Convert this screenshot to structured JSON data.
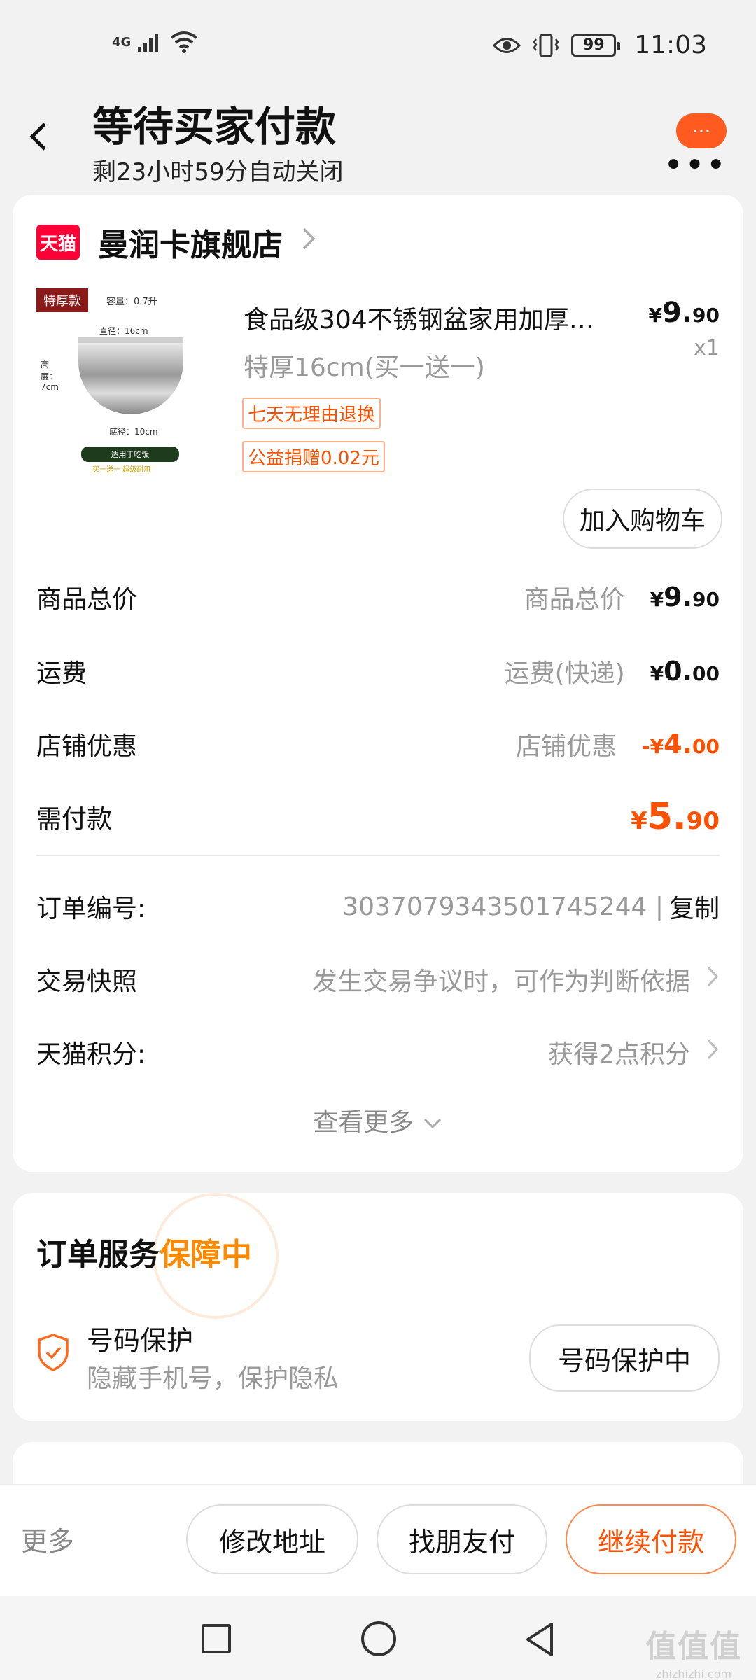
{
  "status_bar": {
    "network": "4G",
    "battery": "99",
    "time": "11:03"
  },
  "header": {
    "title": "等待买家付款",
    "subtitle": "剩23小时59分自动关闭",
    "more_bubble": "···",
    "more_dots": "•••"
  },
  "store": {
    "badge": "天猫",
    "name": "曼润卡旗舰店"
  },
  "product": {
    "image_badge": "特厚款",
    "image_capacity": "容量：0.7升",
    "image_top_dim": "直径：16cm",
    "image_bottom_dim": "底径：10cm",
    "image_height": "高度：7cm",
    "image_bar": "适用于吃饭",
    "image_note": "买一送一 超级耐用",
    "title": "食品级304不锈钢盆家用加厚…",
    "price_symbol": "¥",
    "price_int": "9.",
    "price_dec": "90",
    "quantity": "x1",
    "sku": "特厚16cm(买一送一)",
    "tags": [
      "七天无理由退换",
      "公益捐赠0.02元"
    ],
    "add_to_cart": "加入购物车"
  },
  "summary": [
    {
      "label": "商品总价",
      "desc": "商品总价",
      "prefix": "¥",
      "int": "9.",
      "dec": "90"
    },
    {
      "label": "运费",
      "desc": "运费(快递)",
      "prefix": "¥",
      "int": "0.",
      "dec": "00"
    },
    {
      "label": "店铺优惠",
      "desc": "店铺优惠",
      "prefix": "-¥",
      "int": "4.",
      "dec": "00"
    },
    {
      "label": "需付款",
      "desc": "",
      "prefix": "¥",
      "int": "5.",
      "dec": "90"
    }
  ],
  "order_info": {
    "order_no_label": "订单编号:",
    "order_no": "3037079343501745244 |",
    "copy": "复制",
    "snapshot_label": "交易快照",
    "snapshot_value": "发生交易争议时，可作为判断依据",
    "points_label": "天猫积分:",
    "points_value": "获得2点积分",
    "see_more": "查看更多"
  },
  "service": {
    "title": "订单服务",
    "title_highlight": "保障中",
    "item_name": "号码保护",
    "item_desc": "隐藏手机号，保护隐私",
    "item_button": "号码保护中"
  },
  "bottom_bar": {
    "more": "更多",
    "btn_modify": "修改地址",
    "btn_friend": "找朋友付",
    "btn_pay": "继续付款"
  },
  "watermark": {
    "main": "值值值",
    "domain": "zhizhizhi.com"
  },
  "colors": {
    "accent": "#ff5000",
    "highlight": "#ff8a00",
    "tmall_red": "#ff0036"
  }
}
